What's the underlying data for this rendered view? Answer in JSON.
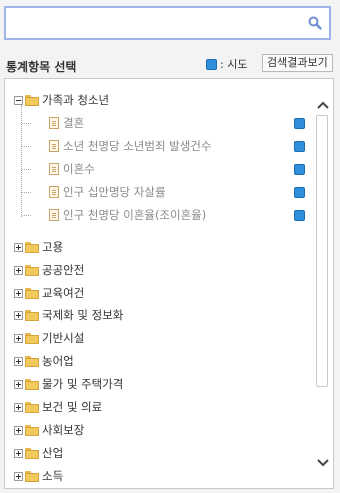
{
  "search": {
    "value": "",
    "placeholder": ""
  },
  "title": "통계항목 선택",
  "legend": {
    "label": ": 시도",
    "color": "#2f8fdc"
  },
  "result_button": "검색결과보기",
  "tree": {
    "expanded": {
      "label": "가족과 청소년",
      "children": [
        "결혼",
        "소년 천명당 소년범죄 발생건수",
        "이혼수",
        "인구 십만명당 자살률",
        "인구 천명당 이혼율(조이혼율)"
      ]
    },
    "collapsed": [
      "고용",
      "공공안전",
      "교육여건",
      "국제화 및 정보화",
      "기반시설",
      "농어업",
      "물가 및 주택가격",
      "보건 및 의료",
      "사회보장",
      "산업",
      "소득"
    ]
  }
}
